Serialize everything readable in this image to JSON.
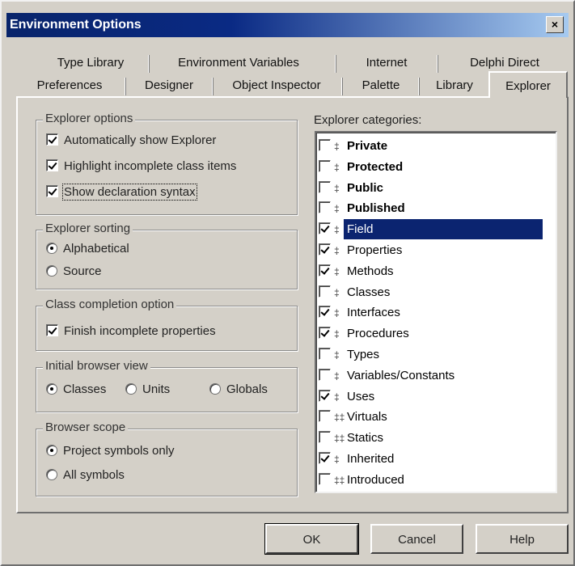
{
  "window": {
    "title": "Environment Options",
    "close_glyph": "×"
  },
  "tabs": {
    "row1": [
      "Type Library",
      "Environment Variables",
      "Internet",
      "Delphi Direct"
    ],
    "row2": [
      "Preferences",
      "Designer",
      "Object Inspector",
      "Palette",
      "Library",
      "Explorer"
    ],
    "active": "Explorer"
  },
  "explorer_options": {
    "title": "Explorer options",
    "items": [
      {
        "label": "Automatically show Explorer",
        "checked": true
      },
      {
        "label": "Highlight incomplete class items",
        "checked": true
      },
      {
        "label": "Show declaration syntax",
        "checked": true
      }
    ]
  },
  "explorer_sorting": {
    "title": "Explorer sorting",
    "options": [
      "Alphabetical",
      "Source"
    ],
    "selected": "Alphabetical"
  },
  "class_completion": {
    "title": "Class completion option",
    "items": [
      {
        "label": "Finish incomplete properties",
        "checked": true
      }
    ]
  },
  "initial_view": {
    "title": "Initial browser view",
    "options": [
      "Classes",
      "Units",
      "Globals"
    ],
    "selected": "Classes"
  },
  "browser_scope": {
    "title": "Browser scope",
    "options": [
      "Project symbols only",
      "All symbols"
    ],
    "selected": "Project symbols only"
  },
  "categories": {
    "title": "Explorer categories:",
    "items": [
      {
        "label": "Private",
        "checked": false,
        "bold": true,
        "symbol": "‡"
      },
      {
        "label": "Protected",
        "checked": false,
        "bold": true,
        "symbol": "‡"
      },
      {
        "label": "Public",
        "checked": false,
        "bold": true,
        "symbol": "‡"
      },
      {
        "label": "Published",
        "checked": false,
        "bold": true,
        "symbol": "‡"
      },
      {
        "label": "Field",
        "checked": true,
        "bold": false,
        "symbol": "‡",
        "selected": true
      },
      {
        "label": "Properties",
        "checked": true,
        "bold": false,
        "symbol": "‡"
      },
      {
        "label": "Methods",
        "checked": true,
        "bold": false,
        "symbol": "‡"
      },
      {
        "label": "Classes",
        "checked": false,
        "bold": false,
        "symbol": "‡"
      },
      {
        "label": "Interfaces",
        "checked": true,
        "bold": false,
        "symbol": "‡"
      },
      {
        "label": "Procedures",
        "checked": true,
        "bold": false,
        "symbol": "‡"
      },
      {
        "label": "Types",
        "checked": false,
        "bold": false,
        "symbol": "‡"
      },
      {
        "label": "Variables/Constants",
        "checked": false,
        "bold": false,
        "symbol": "‡"
      },
      {
        "label": "Uses",
        "checked": true,
        "bold": false,
        "symbol": "‡"
      },
      {
        "label": "Virtuals",
        "checked": false,
        "bold": false,
        "symbol": "‡‡"
      },
      {
        "label": "Statics",
        "checked": false,
        "bold": false,
        "symbol": "‡‡"
      },
      {
        "label": "Inherited",
        "checked": true,
        "bold": false,
        "symbol": "‡"
      },
      {
        "label": "Introduced",
        "checked": false,
        "bold": false,
        "symbol": "‡‡"
      }
    ]
  },
  "buttons": {
    "ok": "OK",
    "cancel": "Cancel",
    "help": "Help"
  },
  "colors": {
    "selection": "#0b2470",
    "title_start": "#08246b",
    "title_end": "#a6caf0"
  }
}
